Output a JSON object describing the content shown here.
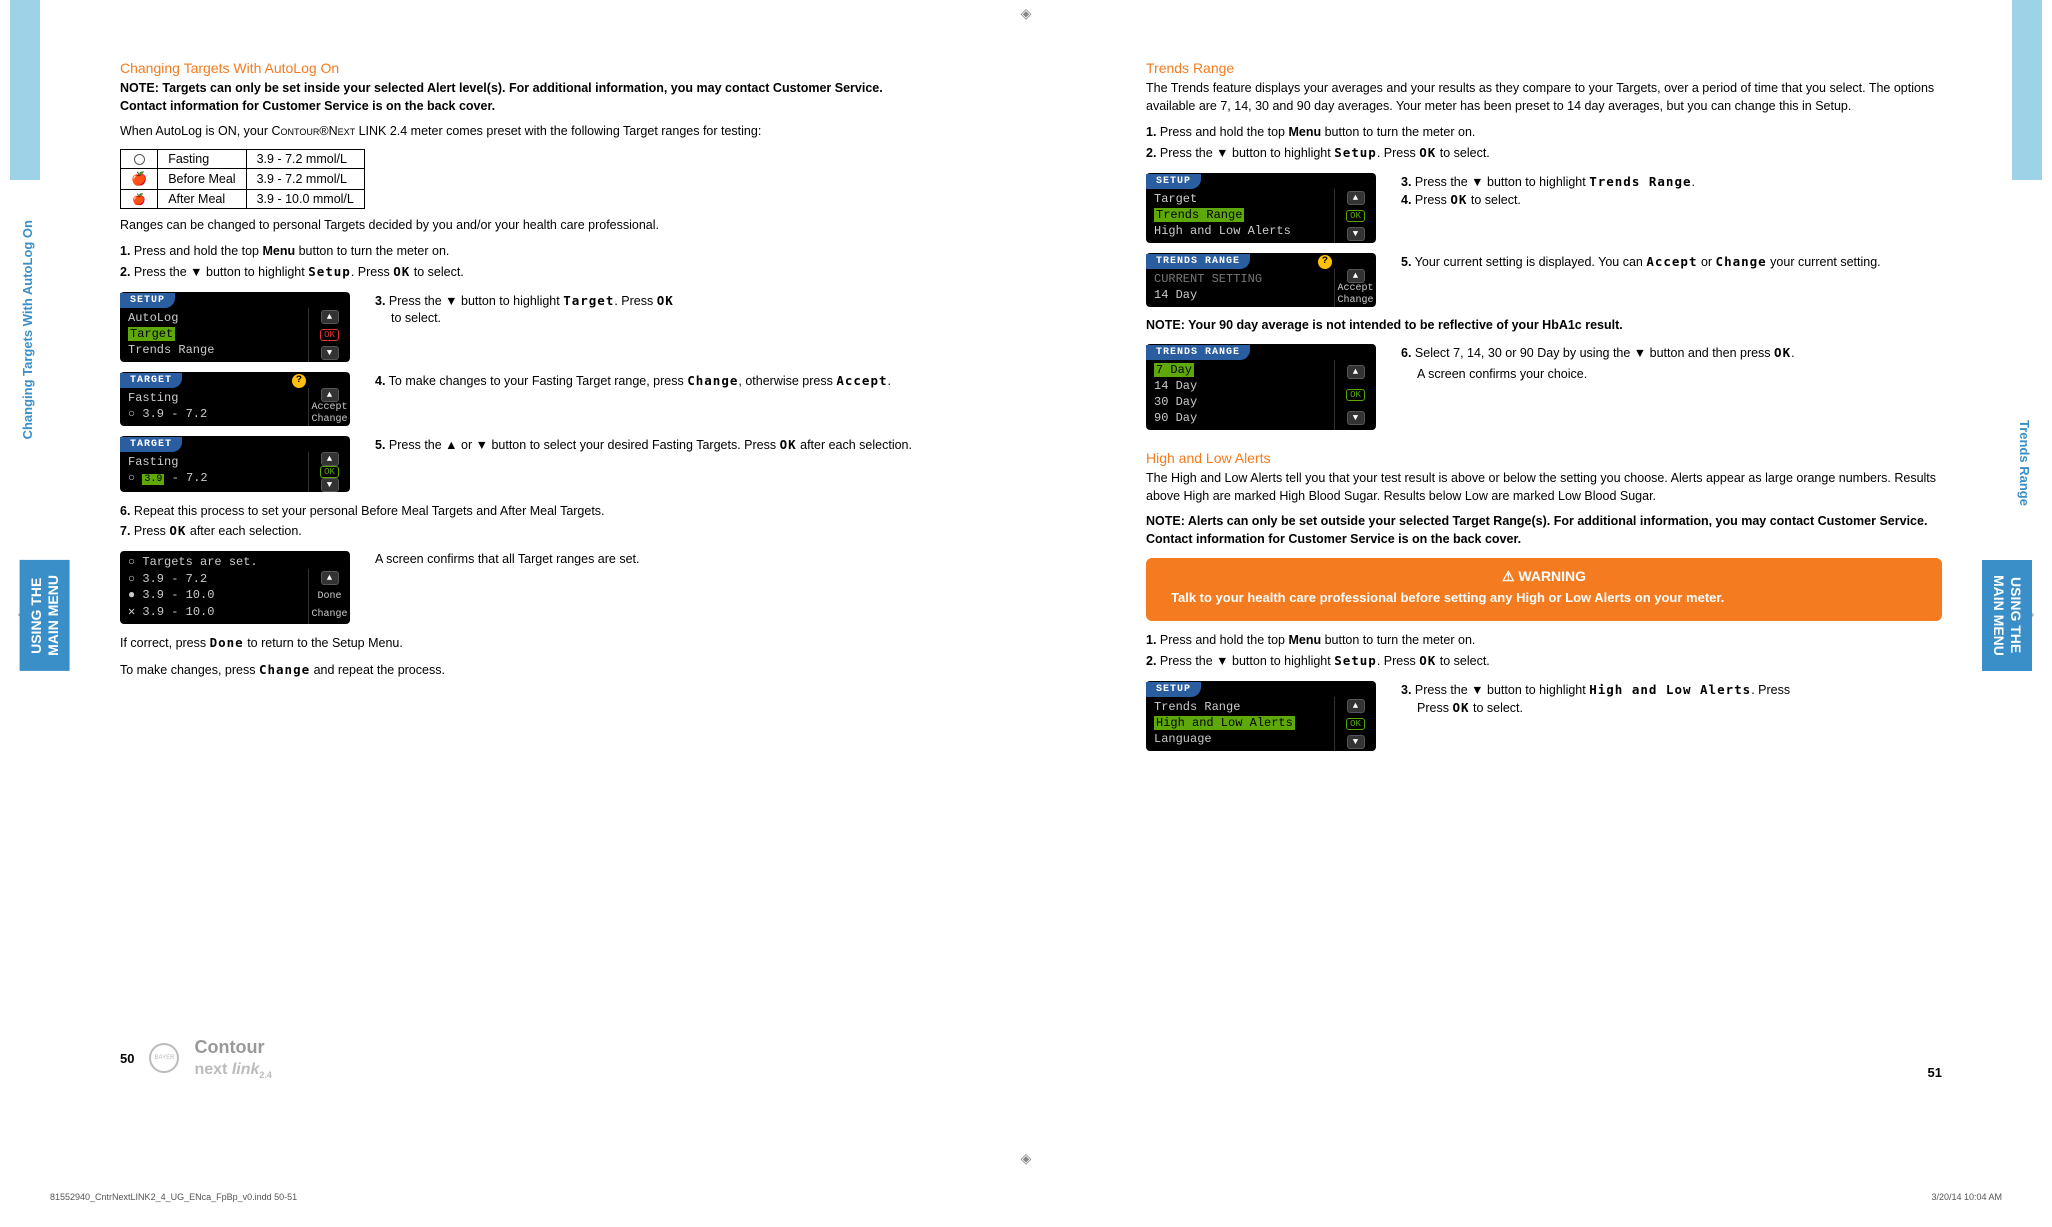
{
  "left": {
    "section_tab": "Changing Targets With AutoLog On",
    "menu_tab": "USING THE\nMAIN MENU",
    "h1": "Changing Targets With AutoLog On",
    "note1": "NOTE: Targets can only be set inside your selected Alert level(s). For additional information, you may contact Customer Service. Contact information for Customer Service is on the back cover.",
    "p1_a": "When AutoLog is ON, your ",
    "p1_b": "Contour",
    "p1_c": "®",
    "p1_d": "Next",
    "p1_e": " LINK 2.4 meter comes preset with the following Target ranges for testing:",
    "table": {
      "rows": [
        {
          "label": "Fasting",
          "range": "3.9 - 7.2 mmol/L"
        },
        {
          "label": "Before Meal",
          "range": "3.9 - 7.2 mmol/L"
        },
        {
          "label": "After Meal",
          "range": "3.9 - 10.0 mmol/L"
        }
      ]
    },
    "p2": "Ranges can be changed to personal Targets decided by you and/or your health care professional.",
    "li1_num": "1.",
    "li1": " Press and hold the top ",
    "li1_b": "Menu",
    "li1_c": " button to turn the meter on.",
    "li2_num": "2.",
    "li2": " Press the ▼ button to highlight ",
    "li2_b": "Setup",
    "li2_c": ". Press ",
    "li2_d": "OK",
    "li2_e": " to select.",
    "dev1": {
      "title": "SETUP",
      "items": [
        "AutoLog",
        "Target",
        "Trends Range"
      ],
      "hl": 1,
      "ok": "OK"
    },
    "s3_num": "3.",
    "s3": " Press the ▼ button to highlight ",
    "s3_b": "Target",
    "s3_c": ". Press ",
    "s3_d": "OK",
    "s3_e": " to select.",
    "dev2": {
      "title": "TARGET",
      "line1": "Fasting",
      "line2": "○ 3.9 - 7.2",
      "btnA": "Accept",
      "btnB": "Change"
    },
    "s4_num": "4.",
    "s4": " To make changes to your Fasting Target range, press ",
    "s4_b": "Change",
    "s4_c": ", otherwise press ",
    "s4_d": "Accept",
    "s4_e": ".",
    "dev3": {
      "title": "TARGET",
      "line1": "Fasting",
      "line2a": "○ ",
      "line2b": "3.9",
      "line2c": " - 7.2",
      "ok": "OK"
    },
    "s5_num": "5.",
    "s5": " Press the ▲ or ▼ button to select your desired Fasting Targets. Press ",
    "s5_b": "OK",
    "s5_c": " after each selection.",
    "li6_num": "6.",
    "li6": " Repeat this process to set your personal Before Meal Targets and After Meal Targets.",
    "li7_num": "7.",
    "li7": " Press ",
    "li7_b": "OK",
    "li7_c": " after each selection.",
    "dev4": {
      "top": "○ Targets are set.",
      "lines": [
        "○ 3.9 - 7.2",
        "● 3.9 - 10.0",
        "✕ 3.9 - 10.0"
      ],
      "btnA": "Done",
      "btnB": "Change"
    },
    "conf": "A screen confirms that all Target ranges are set.",
    "p3_a": "If correct, press ",
    "p3_b": "Done",
    "p3_c": " to return to the Setup Menu.",
    "p4_a": "To make changes, press ",
    "p4_b": "Change",
    "p4_c": " and repeat the process.",
    "page_num": "50",
    "brand_top": "Contour",
    "brand_bot": "next",
    "brand_link": "link",
    "brand_24": "2.4"
  },
  "right": {
    "section_tab": "Trends Range",
    "menu_tab": "USING THE\nMAIN MENU",
    "h1": "Trends Range",
    "p1": "The Trends feature displays your averages and your results as they compare to your Targets, over a period of time that you select. The options available are 7, 14, 30 and 90 day averages. Your meter has been preset to 14 day averages, but you can change this in Setup.",
    "li1_num": "1.",
    "li1": " Press and hold the top ",
    "li1_b": "Menu",
    "li1_c": " button to turn the meter on.",
    "li2_num": "2.",
    "li2": " Press the ▼ button to highlight ",
    "li2_b": "Setup",
    "li2_c": ". Press ",
    "li2_d": "OK",
    "li2_e": " to select.",
    "dev1": {
      "title": "SETUP",
      "items": [
        "Target",
        "Trends Range",
        "High and Low Alerts"
      ],
      "hl": 1,
      "ok": "OK"
    },
    "s3_num": "3.",
    "s3": " Press the ▼ button to highlight ",
    "s3_b": "Trends Range",
    "s3_c": ".",
    "s4_num": "4.",
    "s4": " Press ",
    "s4_b": "OK",
    "s4_c": " to select.",
    "dev2": {
      "title": "TRENDS RANGE",
      "line1": "CURRENT SETTING",
      "line2": "14 Day",
      "btnA": "Accept",
      "btnB": "Change"
    },
    "s5_num": "5.",
    "s5": " Your current setting is displayed. You can ",
    "s5_b": "Accept",
    "s5_c": " or ",
    "s5_d": "Change",
    "s5_e": " your current setting.",
    "note2": "NOTE: Your 90 day average is not intended to be reflective of your HbA1c result.",
    "dev3": {
      "title": "TRENDS RANGE",
      "items": [
        "7 Day",
        "14 Day",
        "30 Day",
        "90 Day"
      ],
      "hl": 0,
      "ok": "OK"
    },
    "s6_num": "6.",
    "s6": " Select 7, 14, 30 or 90 Day by using the ▼ button and then press ",
    "s6_b": "OK",
    "s6_c": ".",
    "s6_d": "A screen confirms your choice.",
    "h2": "High and Low Alerts",
    "p2": "The High and Low Alerts tell you that your test result is above or below the setting you choose. Alerts appear as large orange numbers. Results above High are marked High Blood Sugar. Results below Low are marked Low Blood Sugar.",
    "note3": "NOTE: Alerts can only be set outside your selected Target Range(s). For additional information, you may contact Customer Service. Contact information for Customer Service is on the back cover.",
    "warn_title": "WARNING",
    "warn_body": "Talk to your health care professional before setting any High or Low Alerts on your meter.",
    "li1b_num": "1.",
    "li1b": " Press and hold the top ",
    "li1b_b": "Menu",
    "li1b_c": " button to turn the meter on.",
    "li2b_num": "2.",
    "li2b": " Press the ▼ button to highlight ",
    "li2b_b": "Setup",
    "li2b_c": ". Press ",
    "li2b_d": "OK",
    "li2b_e": " to select.",
    "dev4": {
      "title": "SETUP",
      "items": [
        "Trends Range",
        "High and Low Alerts",
        "Language"
      ],
      "hl": 1,
      "ok": "OK"
    },
    "s3b_num": "3.",
    "s3b": " Press the ▼ button to highlight ",
    "s3b_b": "High and Low Alerts",
    "s3b_c": ". Press ",
    "s3b_d": "OK",
    "s3b_e": " to select.",
    "page_num": "51"
  },
  "footer": {
    "file": "81552940_CntrNextLINK2_4_UG_ENca_FpBp_v0.indd   50-51",
    "date": "3/20/14   10:04 AM"
  }
}
